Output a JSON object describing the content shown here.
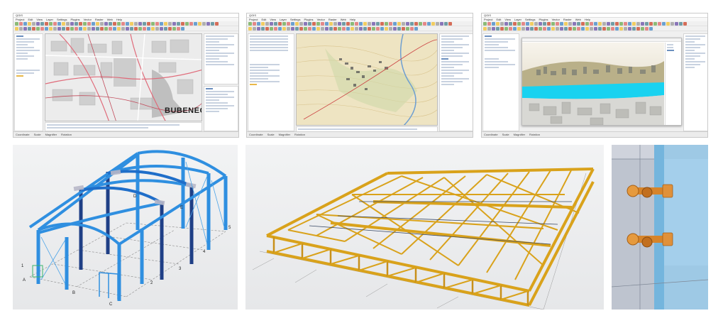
{
  "app_window_1": {
    "title": "QGIS",
    "menu": [
      "Project",
      "Edit",
      "View",
      "Layer",
      "Settings",
      "Plugins",
      "Vector",
      "Raster",
      "Web",
      "Help"
    ],
    "map_label": "BUBENEČ",
    "status": [
      "Coordinate",
      "Scale",
      "Magnifier",
      "Rotation"
    ],
    "toolbar_colors": [
      "#6aa84f",
      "#e06666",
      "#3d85c6",
      "#f1c232",
      "#999999",
      "#674ea7",
      "#45818e",
      "#cc4125"
    ]
  },
  "app_window_2": {
    "title": "QGIS",
    "menu": [
      "Project",
      "Edit",
      "View",
      "Layer",
      "Settings",
      "Plugins",
      "Vector",
      "Raster",
      "Web",
      "Help"
    ],
    "status": [
      "Coordinate",
      "Scale",
      "Magnifier",
      "Rotation"
    ]
  },
  "app_window_3": {
    "title": "QGIS",
    "menu": [
      "Project",
      "Edit",
      "View",
      "Layer",
      "Settings",
      "Plugins",
      "Vector",
      "Raster",
      "Web",
      "Help"
    ],
    "status": [
      "Coordinate",
      "Scale",
      "Magnifier",
      "Rotation"
    ]
  },
  "frame_model": {
    "grid_letters": [
      "A",
      "B",
      "C",
      "D",
      "E"
    ],
    "grid_numbers": [
      "1",
      "2",
      "3",
      "4",
      "5"
    ],
    "frame_color": "#2f8fe0",
    "dark_member_color": "#1f3f86"
  },
  "truss_model": {
    "timber_color": "#d9a21b"
  },
  "bolt_detail": {
    "plate_color": "#8ec6e8",
    "bolt_color": "#d6842a"
  }
}
